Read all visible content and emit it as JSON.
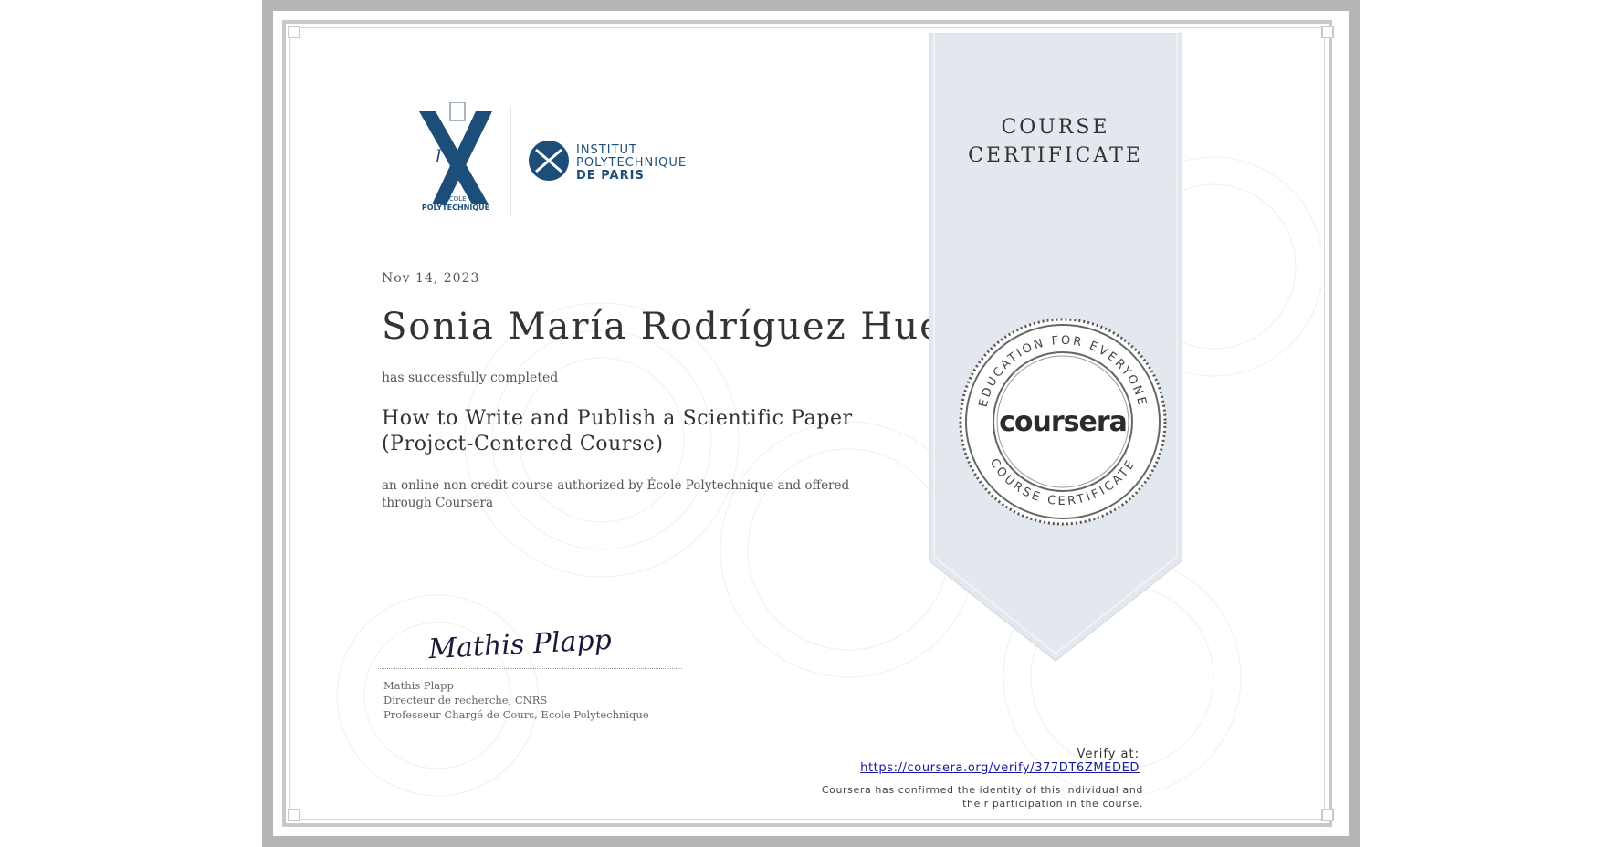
{
  "certificate": {
    "date": "Nov 14, 2023",
    "recipient_name": "Sonia María Rodríguez Huerta",
    "completed_text": "has successfully completed",
    "course_title_line1": "How to Write and Publish a Scientific Paper",
    "course_title_line2": "(Project-Centered Course)",
    "description": "an online non-credit course authorized by École Polytechnique and offered through Coursera"
  },
  "logos": {
    "ecole_l": "l'",
    "ecole_line1": "ÉCOLE",
    "ecole_line2": "POLYTECHNIQUE",
    "ipp_line1": "INSTITUT",
    "ipp_line2": "POLYTECHNIQUE",
    "ipp_line3": "DE PARIS"
  },
  "signer": {
    "name": "Mathis Plapp",
    "title1": "Directeur de recherche, CNRS",
    "title2": "Professeur Chargé de Cours, Ecole Polytechnique",
    "signature_text": "Mathis Plapp"
  },
  "ribbon": {
    "line1": "COURSE",
    "line2": "CERTIFICATE"
  },
  "seal": {
    "brand": "coursera",
    "top_arc": "EDUCATION FOR EVERYONE",
    "bottom_arc": "COURSE CERTIFICATE"
  },
  "verify": {
    "label": "Verify at:",
    "url": "https://coursera.org/verify/377DT6ZMEDED",
    "confirm_line1": "Coursera has confirmed the identity of this individual and",
    "confirm_line2": "their participation in the course."
  },
  "colors": {
    "navy": "#1d4e7a",
    "ribbon": "#e3e8ef",
    "link": "#1a1aa0"
  }
}
